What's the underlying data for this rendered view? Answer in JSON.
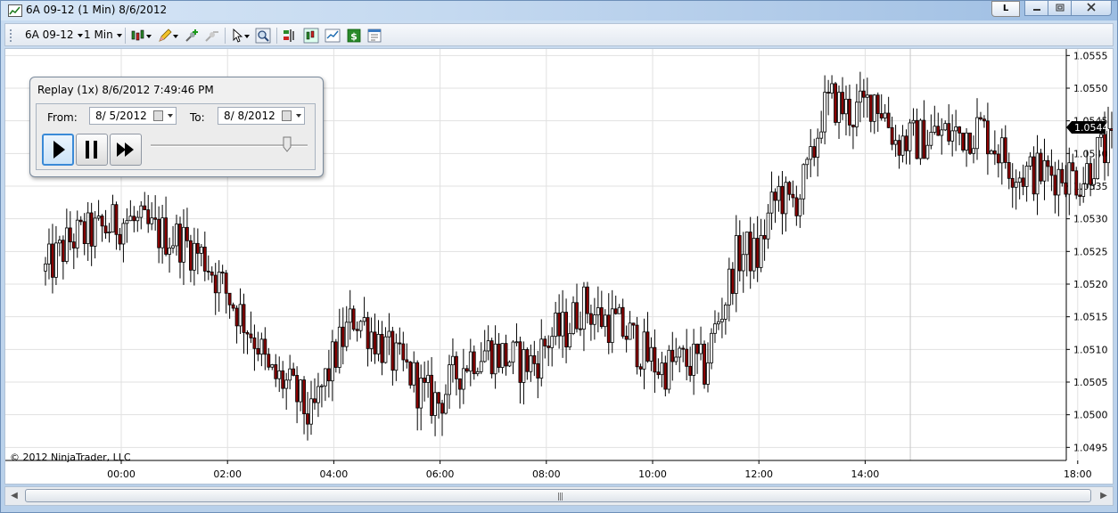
{
  "window": {
    "title": "6A 09-12 (1 Min)  8/6/2012",
    "layout_button": "L"
  },
  "toolbar": {
    "instrument": "6A 09-12",
    "interval": "1 Min"
  },
  "replay": {
    "title": "Replay (1x) 8/6/2012 7:49:46 PM",
    "from_label": "From:",
    "from_date": "8/  5/2012",
    "to_label": "To:",
    "to_date": "8/  8/2012",
    "speed_fraction": 0.87
  },
  "copyright": "© 2012 NinjaTrader, LLC",
  "chart_data": {
    "type": "candlestick",
    "x_tick_labels": [
      "00:00",
      "02:00",
      "04:00",
      "06:00",
      "08:00",
      "10:00",
      "12:00",
      "14:00",
      "18:00"
    ],
    "y_tick_labels": [
      "1.0495",
      "1.0500",
      "1.0505",
      "1.0510",
      "1.0515",
      "1.0520",
      "1.0525",
      "1.0530",
      "1.0535",
      "1.0540",
      "1.0545",
      "1.0550",
      "1.0555"
    ],
    "ylim": [
      1.0493,
      1.0556
    ],
    "last_price": "1.0544",
    "grid": true,
    "colors": {
      "up": "#ffffff",
      "down": "#8b0000",
      "wick": "#000000",
      "grid": "#e1e1e1"
    },
    "path": [
      [
        0,
        1.0522
      ],
      [
        0.5,
        1.0527
      ],
      [
        1,
        1.0528
      ],
      [
        1.5,
        1.053
      ],
      [
        2,
        1.0528
      ],
      [
        2.5,
        1.0527
      ],
      [
        3,
        1.0524
      ],
      [
        3.3,
        1.052
      ],
      [
        3.7,
        1.0515
      ],
      [
        4,
        1.0511
      ],
      [
        4.2,
        1.0506
      ],
      [
        4.5,
        1.0505
      ],
      [
        4.8,
        1.0502
      ],
      [
        5,
        1.0499
      ],
      [
        5.2,
        1.0504
      ],
      [
        5.5,
        1.051
      ],
      [
        5.8,
        1.0515
      ],
      [
        6,
        1.0514
      ],
      [
        6.3,
        1.0511
      ],
      [
        6.6,
        1.0508
      ],
      [
        6.9,
        1.0506
      ],
      [
        7.1,
        1.0503
      ],
      [
        7.4,
        1.0502
      ],
      [
        7.7,
        1.0506
      ],
      [
        8,
        1.0509
      ],
      [
        8.3,
        1.051
      ],
      [
        8.6,
        1.0509
      ],
      [
        8.9,
        1.0508
      ],
      [
        9.2,
        1.0508
      ],
      [
        9.5,
        1.0512
      ],
      [
        9.8,
        1.0513
      ],
      [
        10.1,
        1.0517
      ],
      [
        10.4,
        1.0515
      ],
      [
        10.7,
        1.0514
      ],
      [
        11,
        1.0512
      ],
      [
        11.3,
        1.0509
      ],
      [
        11.6,
        1.0507
      ],
      [
        11.9,
        1.0508
      ],
      [
        12.2,
        1.0508
      ],
      [
        12.4,
        1.0507
      ],
      [
        12.6,
        1.0513
      ],
      [
        12.8,
        1.0518
      ],
      [
        13,
        1.0524
      ],
      [
        13.2,
        1.0525
      ],
      [
        13.4,
        1.0524
      ],
      [
        13.6,
        1.053
      ],
      [
        13.8,
        1.0534
      ],
      [
        14,
        1.0532
      ],
      [
        14.2,
        1.0534
      ],
      [
        14.4,
        1.0538
      ],
      [
        14.6,
        1.0546
      ],
      [
        14.8,
        1.0548
      ],
      [
        15,
        1.0547
      ],
      [
        15.2,
        1.0546
      ],
      [
        15.4,
        1.0547
      ],
      [
        15.6,
        1.0549
      ],
      [
        15.8,
        1.0546
      ],
      [
        16,
        1.0542
      ],
      [
        16.4,
        1.0542
      ],
      [
        16.8,
        1.0543
      ],
      [
        17.2,
        1.0543
      ],
      [
        17.6,
        1.0544
      ],
      [
        18,
        1.054
      ],
      [
        18.3,
        1.0537
      ],
      [
        18.6,
        1.0537
      ],
      [
        18.9,
        1.0537
      ],
      [
        19.2,
        1.0537
      ],
      [
        19.5,
        1.0536
      ],
      [
        19.8,
        1.054
      ],
      [
        20.2,
        1.0541
      ],
      [
        20.5,
        1.0545
      ],
      [
        20.8,
        1.0544
      ],
      [
        21,
        1.0538
      ],
      [
        21.2,
        1.0532
      ],
      [
        21.4,
        1.0529
      ],
      [
        21.7,
        1.0529
      ],
      [
        22,
        1.0529
      ],
      [
        22.3,
        1.0527
      ],
      [
        22.6,
        1.0526
      ],
      [
        22.9,
        1.0525
      ],
      [
        23.2,
        1.0525
      ],
      [
        23.5,
        1.0521
      ],
      [
        23.8,
        1.0519
      ],
      [
        24.1,
        1.052
      ],
      [
        24.4,
        1.052
      ],
      [
        24.7,
        1.0519
      ],
      [
        25,
        1.0516
      ],
      [
        25.3,
        1.052
      ],
      [
        25.6,
        1.052
      ],
      [
        25.9,
        1.0523
      ],
      [
        26.1,
        1.0526
      ],
      [
        26.3,
        1.053
      ],
      [
        26.5,
        1.0536
      ],
      [
        26.7,
        1.0543
      ],
      [
        26.8,
        1.0544
      ]
    ]
  }
}
